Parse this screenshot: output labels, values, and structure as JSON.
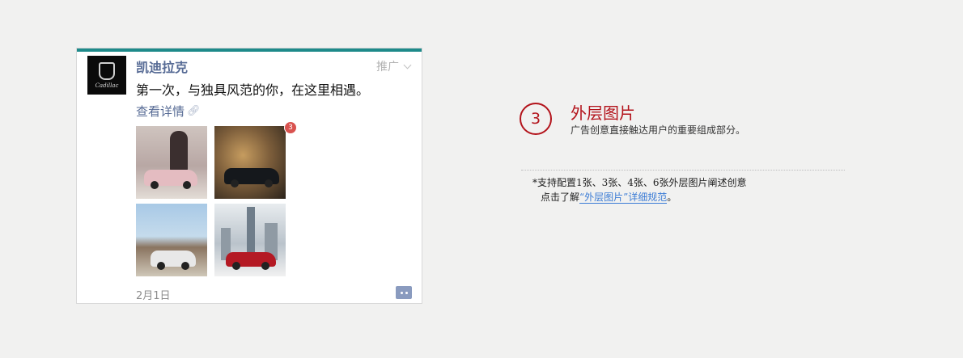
{
  "ad_card": {
    "account_name": "凯迪拉克",
    "avatar_text": "Cadillac",
    "ad_label": "推广",
    "headline": "第一次，与独具风范的你，在这里相遇。",
    "details_link": "查看详情",
    "image_count_badge": "3",
    "images": [
      {
        "icon": "vintage-car-photo"
      },
      {
        "icon": "black-sedan-photo"
      },
      {
        "icon": "white-suv-photo"
      },
      {
        "icon": "red-sedan-city-photo"
      }
    ],
    "date": "2月1日",
    "comment_icon": "comment-icon",
    "accent_color": "#1e8a8a"
  },
  "guide": {
    "step_number": "3",
    "title": "外层图片",
    "description": "广告创意直接触达用户的重要组成部分。",
    "note": "*支持配置1张、3张、4张、6张外层图片阐述创意",
    "link_prefix": "点击了解",
    "link_text": "“外层图片”详细规范",
    "link_suffix": "。",
    "accent_color": "#b3131b"
  }
}
